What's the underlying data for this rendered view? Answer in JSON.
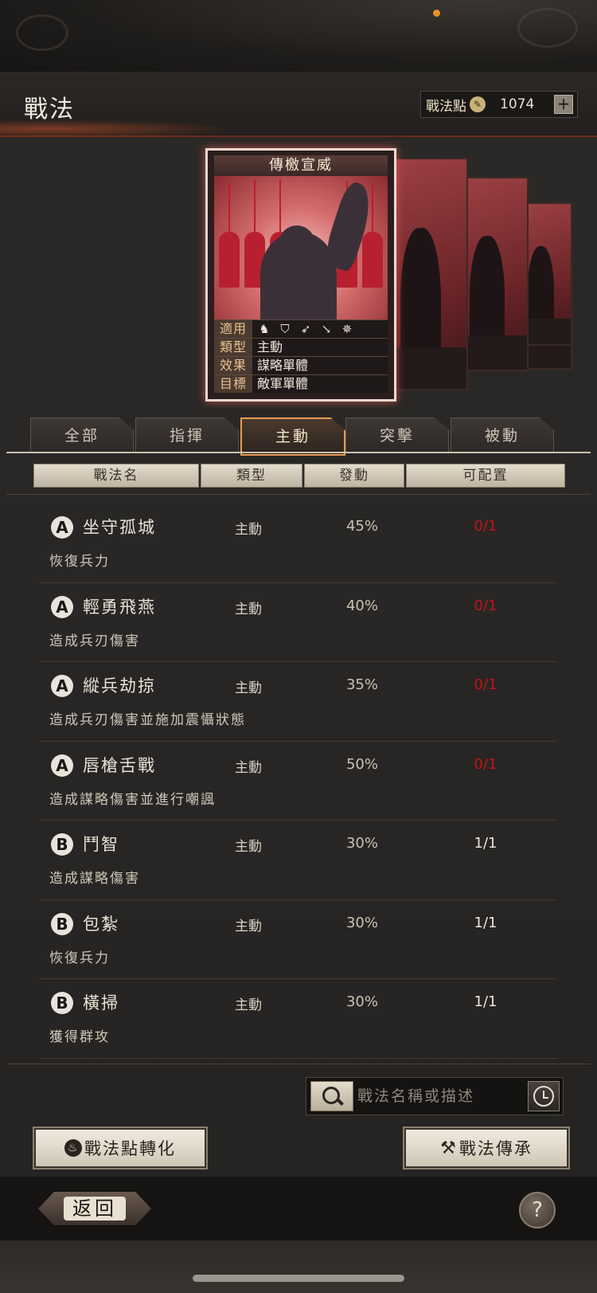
{
  "header": {
    "title": "戰法",
    "points_label": "戰法點",
    "points_value": "1074",
    "plus": "+"
  },
  "card": {
    "title": "傳檄宣威",
    "rows": [
      {
        "label": "適用",
        "icons": [
          "cavalry-icon",
          "shield-icon",
          "bow-icon",
          "spear-icon",
          "wheel-icon"
        ]
      },
      {
        "label": "類型",
        "value": "主動"
      },
      {
        "label": "效果",
        "value": "謀略單體"
      },
      {
        "label": "目標",
        "value": "敵軍單體"
      }
    ]
  },
  "tabs": [
    {
      "label": "全部"
    },
    {
      "label": "指揮"
    },
    {
      "label": "主動",
      "active": true
    },
    {
      "label": "突擊"
    },
    {
      "label": "被動"
    }
  ],
  "columns": [
    "戰法名",
    "類型",
    "發動",
    "可配置"
  ],
  "skills": [
    {
      "grade": "A",
      "name": "坐守孤城",
      "type": "主動",
      "rate": "45%",
      "slots": "0/1",
      "slot_color": "#c2121c",
      "desc": "恢復兵力"
    },
    {
      "grade": "A",
      "name": "輕勇飛燕",
      "type": "主動",
      "rate": "40%",
      "slots": "0/1",
      "slot_color": "#c2121c",
      "desc": "造成兵刃傷害"
    },
    {
      "grade": "A",
      "name": "縱兵劫掠",
      "type": "主動",
      "rate": "35%",
      "slots": "0/1",
      "slot_color": "#c2121c",
      "desc": "造成兵刃傷害並施加震懾狀態"
    },
    {
      "grade": "A",
      "name": "唇槍舌戰",
      "type": "主動",
      "rate": "50%",
      "slots": "0/1",
      "slot_color": "#c2121c",
      "desc": "造成謀略傷害並進行嘲諷"
    },
    {
      "grade": "B",
      "name": "鬥智",
      "type": "主動",
      "rate": "30%",
      "slots": "1/1",
      "slot_color": "#ece6da",
      "desc": "造成謀略傷害"
    },
    {
      "grade": "B",
      "name": "包紮",
      "type": "主動",
      "rate": "30%",
      "slots": "1/1",
      "slot_color": "#ece6da",
      "desc": "恢復兵力"
    },
    {
      "grade": "B",
      "name": "橫掃",
      "type": "主動",
      "rate": "30%",
      "slots": "1/1",
      "slot_color": "#ece6da",
      "desc": "獲得群攻"
    }
  ],
  "search": {
    "placeholder": "戰法名稱或描述",
    "value": ""
  },
  "buttons": {
    "convert": "戰法點轉化",
    "inherit": "戰法傳承",
    "back": "返回",
    "help": "?"
  },
  "colors": {
    "accent_orange": "#e89a52",
    "slot_full": "#c2121c"
  }
}
